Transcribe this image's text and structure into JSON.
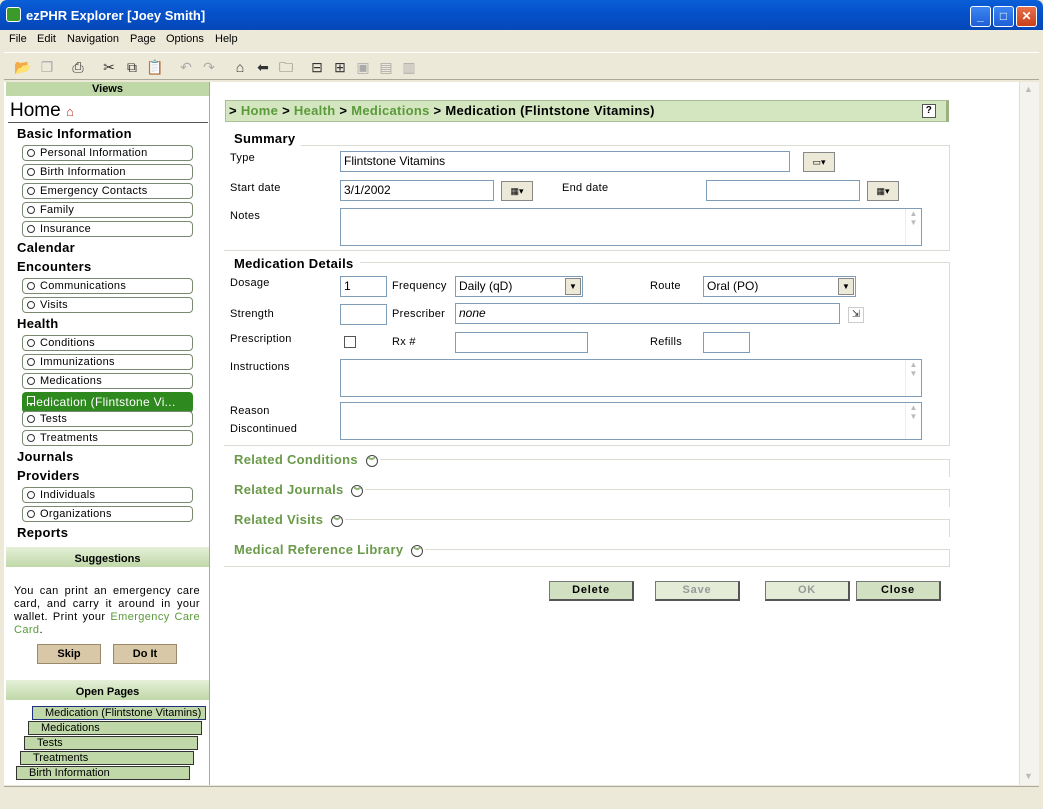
{
  "window": {
    "title": "ezPHR Explorer [Joey Smith]",
    "min": "_",
    "max": "□",
    "close": "✕"
  },
  "menu": [
    "File",
    "Edit",
    "Navigation",
    "Page",
    "Options",
    "Help"
  ],
  "sidebar": {
    "views_label": "Views",
    "home_label": "Home",
    "sections": {
      "basic": "Basic Information",
      "calendar": "Calendar",
      "encounters": "Encounters",
      "health": "Health",
      "journals": "Journals",
      "providers": "Providers",
      "reports": "Reports"
    },
    "items": {
      "personal": "Personal Information",
      "birth": "Birth Information",
      "emergency": "Emergency Contacts",
      "family": "Family",
      "insurance": "Insurance",
      "communications": "Communications",
      "visits": "Visits",
      "conditions": "Conditions",
      "immunizations": "Immunizations",
      "medications": "Medications",
      "medication_current": "Medication (Flintstone Vi...",
      "tests": "Tests",
      "treatments": "Treatments",
      "individuals": "Individuals",
      "organizations": "Organizations"
    },
    "suggestions_label": "Suggestions",
    "suggestion_text": "You can print an emergency care card, and carry it around in your wallet. Print your",
    "suggestion_link": "Emergency Care Card",
    "suggestion_end": ".",
    "skip_label": "Skip",
    "doit_label": "Do It",
    "open_pages_label": "Open Pages",
    "open_pages": [
      "Medication (Flintstone Vitamins)",
      "Medications",
      "Tests",
      "Treatments",
      "Birth Information"
    ]
  },
  "breadcrumb": {
    "prefix": ">",
    "home": "Home",
    "health": "Health",
    "medications": "Medications",
    "sep": ">",
    "current": "Medication (Flintstone Vitamins)",
    "help": "?"
  },
  "summary": {
    "legend": "Summary",
    "type_label": "Type",
    "type_value": "Flintstone Vitamins",
    "start_label": "Start date",
    "start_value": "3/1/2002",
    "end_label": "End date",
    "end_value": "",
    "notes_label": "Notes",
    "notes_value": ""
  },
  "details": {
    "legend": "Medication Details",
    "dosage_label": "Dosage",
    "dosage_value": "1",
    "frequency_label": "Frequency",
    "frequency_value": "Daily (qD)",
    "route_label": "Route",
    "route_value": "Oral (PO)",
    "strength_label": "Strength",
    "strength_value": "",
    "prescriber_label": "Prescriber",
    "prescriber_value": "none",
    "prescription_label": "Prescription",
    "prescription_checked": false,
    "rx_label": "Rx #",
    "rx_value": "",
    "refills_label": "Refills",
    "refills_value": "",
    "instructions_label": "Instructions",
    "reason_label1": "Reason",
    "reason_label2": "Discontinued"
  },
  "related": {
    "conditions": "Related Conditions",
    "journals": "Related Journals",
    "visits": "Related Visits",
    "library": "Medical Reference Library"
  },
  "buttons": {
    "delete": "Delete",
    "save": "Save",
    "ok": "OK",
    "close": "Close"
  }
}
